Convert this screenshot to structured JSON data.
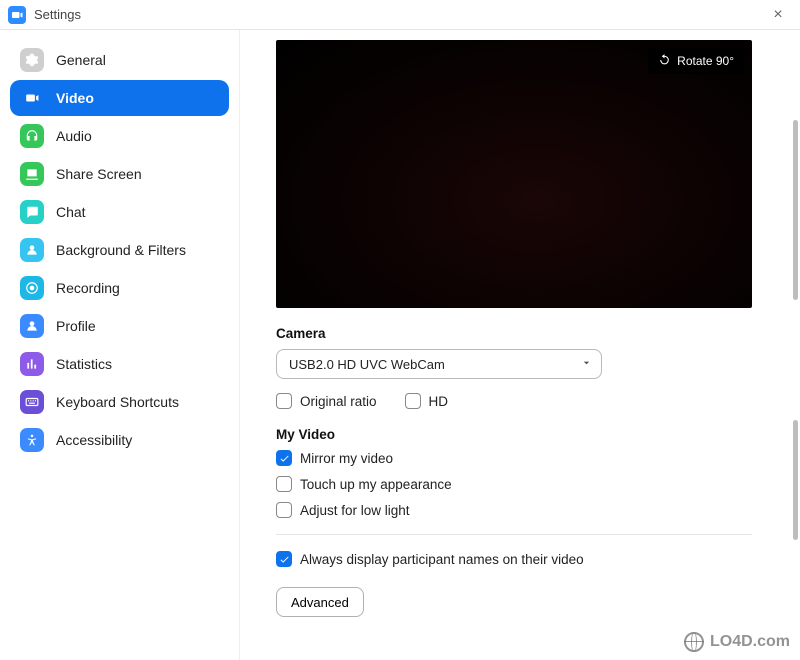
{
  "window": {
    "title": "Settings",
    "close_label": "×"
  },
  "sidebar": {
    "items": [
      {
        "label": "General",
        "icon": "gear-icon",
        "color": "#CFCFCF",
        "active": false
      },
      {
        "label": "Video",
        "icon": "video-icon",
        "color": "#FFFFFF",
        "active": true
      },
      {
        "label": "Audio",
        "icon": "headphones-icon",
        "color": "#35C75A",
        "active": false
      },
      {
        "label": "Share Screen",
        "icon": "share-icon",
        "color": "#35C75A",
        "active": false
      },
      {
        "label": "Chat",
        "icon": "chat-icon",
        "color": "#27D1C8",
        "active": false
      },
      {
        "label": "Background & Filters",
        "icon": "person-bg-icon",
        "color": "#36C5F0",
        "active": false
      },
      {
        "label": "Recording",
        "icon": "record-icon",
        "color": "#1EB8E6",
        "active": false
      },
      {
        "label": "Profile",
        "icon": "profile-icon",
        "color": "#3B8BFF",
        "active": false
      },
      {
        "label": "Statistics",
        "icon": "stats-icon",
        "color": "#8E5BE8",
        "active": false
      },
      {
        "label": "Keyboard Shortcuts",
        "icon": "keyboard-icon",
        "color": "#6B4FD8",
        "active": false
      },
      {
        "label": "Accessibility",
        "icon": "accessibility-icon",
        "color": "#3B8BFF",
        "active": false
      }
    ]
  },
  "video": {
    "rotate_label": "Rotate 90°",
    "camera_section": "Camera",
    "camera_selected": "USB2.0 HD UVC WebCam",
    "original_ratio": {
      "label": "Original ratio",
      "checked": false
    },
    "hd": {
      "label": "HD",
      "checked": false
    },
    "my_video_section": "My Video",
    "mirror": {
      "label": "Mirror my video",
      "checked": true
    },
    "touch_up": {
      "label": "Touch up my appearance",
      "checked": false
    },
    "low_light": {
      "label": "Adjust for low light",
      "checked": false
    },
    "display_names": {
      "label": "Always display participant names on their video",
      "checked": true
    },
    "advanced_label": "Advanced"
  },
  "watermark": "LO4D.com"
}
